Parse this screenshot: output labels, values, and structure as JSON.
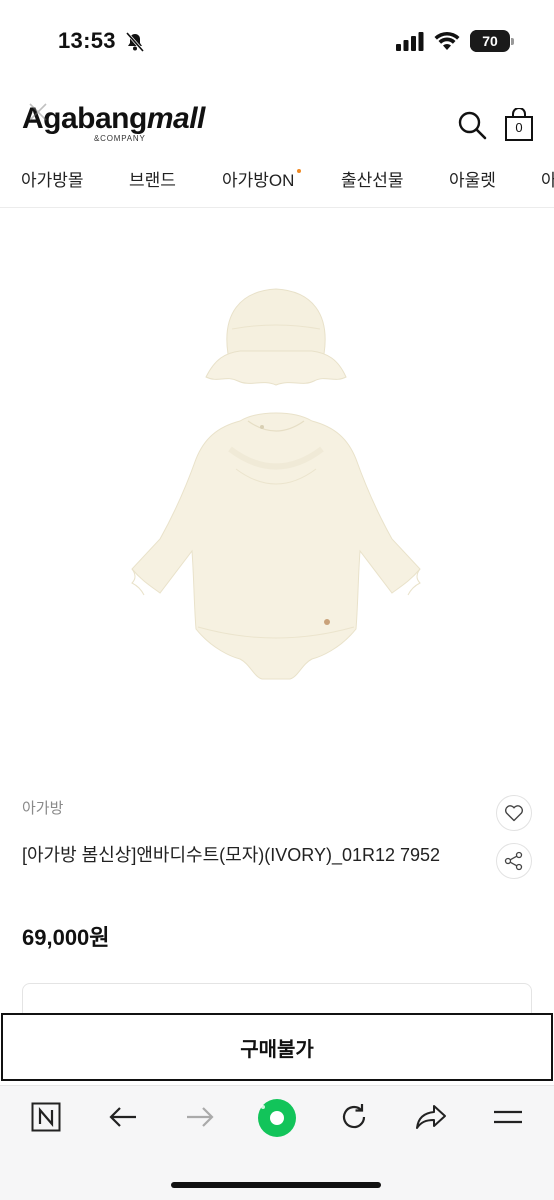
{
  "status_bar": {
    "time": "13:53",
    "battery": "70",
    "battery_level": 0.7
  },
  "header": {
    "logo_main": "Agabang",
    "logo_mall": "mall",
    "logo_sub": "&COMPANY",
    "cart_count": "0"
  },
  "nav": {
    "items": [
      "아가방몰",
      "브랜드",
      "아가방ON",
      "출산선물",
      "아울렛",
      "아"
    ]
  },
  "product": {
    "brand": "아가방",
    "title": "[아가방 봄신상]앤바디수트(모자)(IVORY)_01R12 7952",
    "price": "69,000원"
  },
  "buy": {
    "label": "구매불가"
  },
  "colors": {
    "accent_dot": "#f08a24",
    "garment": "#f6f1e1",
    "browser_green": "#12c45a"
  },
  "icons": [
    "close-icon",
    "search-icon",
    "cart-icon",
    "heart-icon",
    "share-icon",
    "n-icon",
    "back-icon",
    "forward-icon",
    "green-dot-icon",
    "refresh-icon",
    "share-arrow-icon",
    "menu-icon"
  ]
}
